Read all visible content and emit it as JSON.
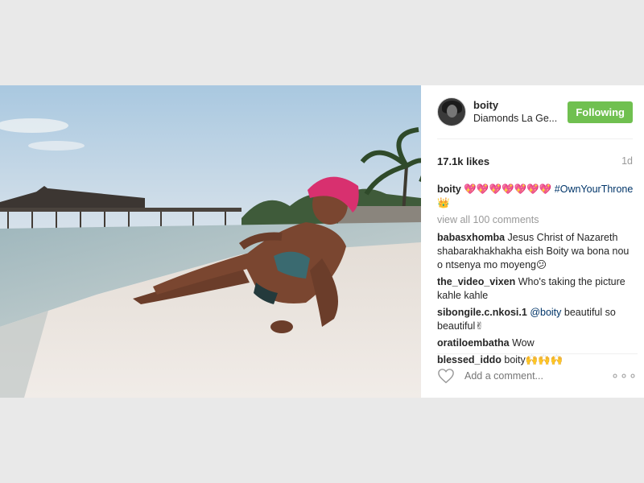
{
  "post": {
    "username": "boity",
    "location": "Diamonds La Ge...",
    "follow_label": "Following",
    "likes": "17.1k likes",
    "age": "1d",
    "caption": {
      "user": "boity",
      "emoji": "💖💖💖💖💖💖💖",
      "tag": "#OwnYourThrone👑"
    },
    "view_all": "view all 100 comments",
    "comments": [
      {
        "user": "babasxhomba",
        "text": " Jesus Christ of Nazareth shabarakhakhakha eish Boity wa bona nou o ntsenya mo moyeng😕"
      },
      {
        "user": "the_video_vixen",
        "text": " Who's taking the picture kahle kahle"
      },
      {
        "user": "sibongile.c.nkosi.1",
        "mention": " @boity",
        "text": " beautiful so beautiful✌"
      },
      {
        "user": "oratiloembatha",
        "text": " Wow"
      },
      {
        "user": "blessed_iddo",
        "text": " boity🙌🙌🙌"
      }
    ],
    "add_comment_placeholder": "Add a comment...",
    "more_glyph": "∘∘∘"
  },
  "icons": {
    "heart": "heart-icon",
    "more": "more-options-icon"
  },
  "colors": {
    "follow_button": "#70c050",
    "link": "#003569",
    "muted": "#999999"
  }
}
